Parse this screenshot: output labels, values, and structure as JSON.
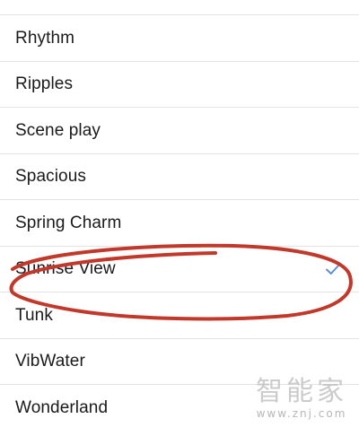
{
  "ringtone_list": {
    "items": [
      {
        "label": "Rhythm",
        "selected": false
      },
      {
        "label": "Ripples",
        "selected": false
      },
      {
        "label": "Scene play",
        "selected": false
      },
      {
        "label": "Spacious",
        "selected": false
      },
      {
        "label": "Spring Charm",
        "selected": false
      },
      {
        "label": "Sunrise View",
        "selected": true
      },
      {
        "label": "Tunk",
        "selected": false
      },
      {
        "label": "VibWater",
        "selected": false
      },
      {
        "label": "Wonderland",
        "selected": false
      }
    ]
  },
  "colors": {
    "checkmark": "#5a8fd8",
    "annotation_circle": "#c0392b",
    "divider": "#e3e3e3",
    "text": "#1a1a1a"
  },
  "watermark": {
    "logo_text": "智能家",
    "url_text": "www.znj.com"
  }
}
